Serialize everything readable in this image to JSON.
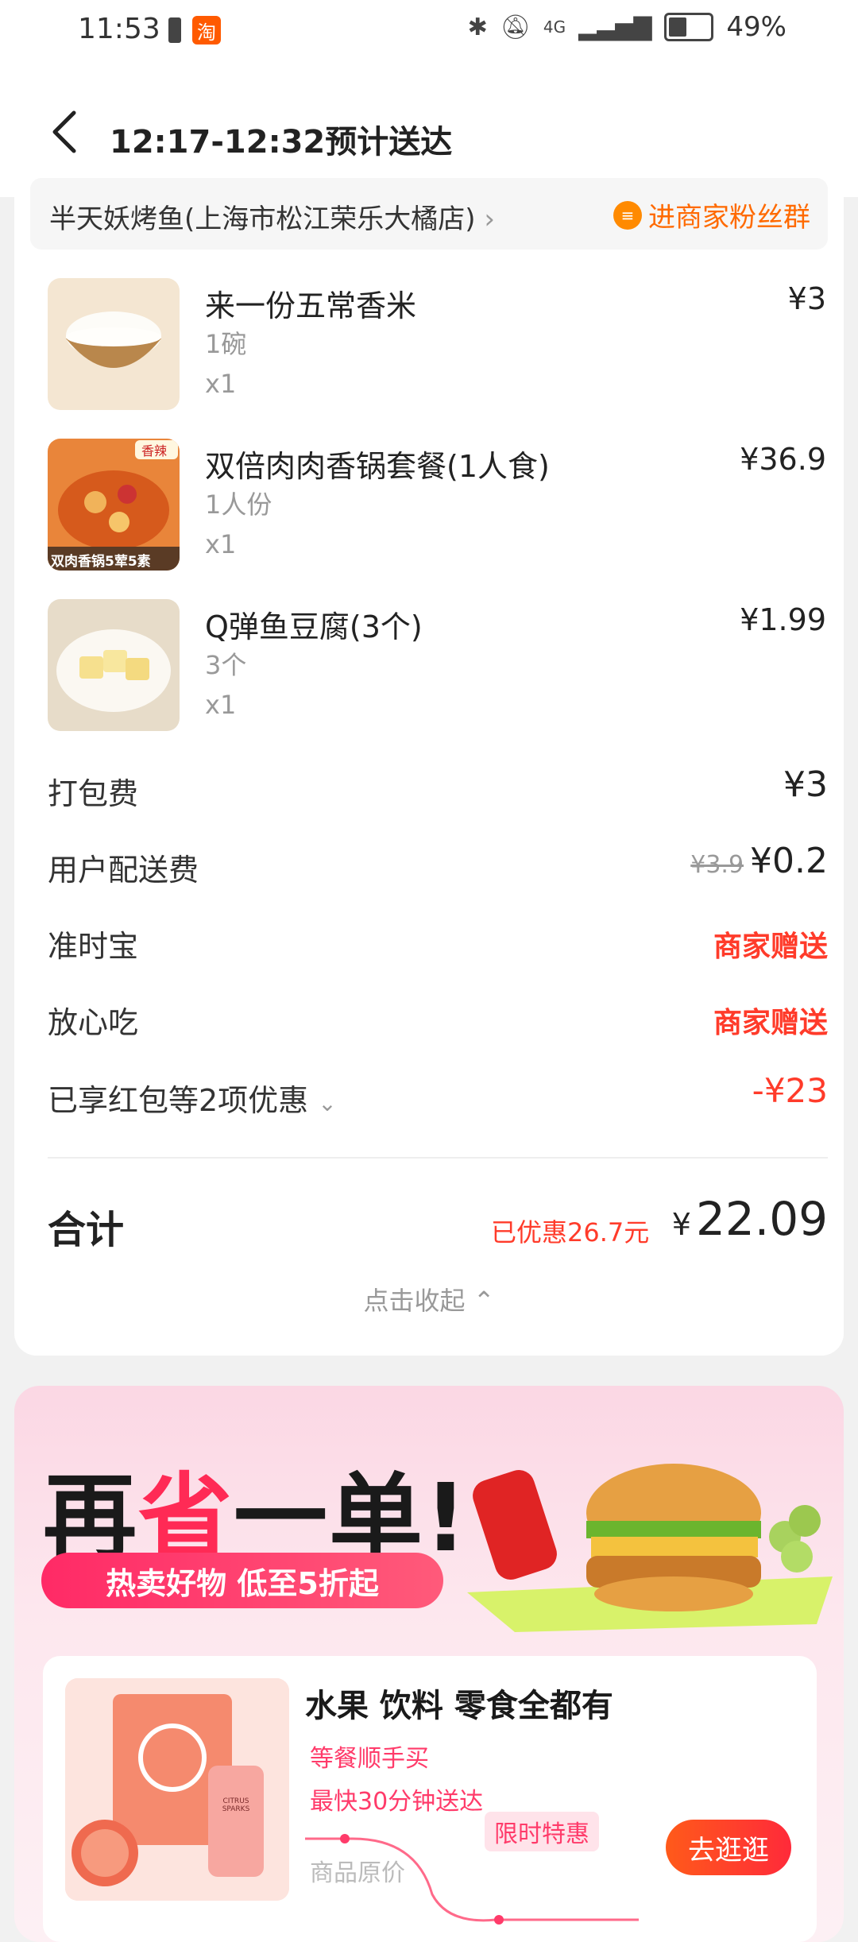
{
  "status_bar": {
    "time": "11:53",
    "taobao_badge": "淘",
    "network": "4G",
    "battery": "49%"
  },
  "header": {
    "title": "12:17-12:32预计送达"
  },
  "store": {
    "name": "半天妖烤鱼(上海市松江荣乐大橘店)",
    "fan_group": "进商家粉丝群"
  },
  "items": [
    {
      "name": "来一份五常香米",
      "spec": "1碗",
      "qty": "x1",
      "price": "¥3"
    },
    {
      "name": "双倍肉肉香锅套餐(1人食)",
      "spec": "1人份",
      "qty": "x1",
      "price": "¥36.9",
      "badge": "香辣",
      "caption": "双肉香锅5荤5素"
    },
    {
      "name": "Q弹鱼豆腐(3个)",
      "spec": "3个",
      "qty": "x1",
      "price": "¥1.99"
    }
  ],
  "fees": {
    "packing": {
      "label": "打包费",
      "value": "¥3"
    },
    "delivery": {
      "label": "用户配送费",
      "original": "¥3.9",
      "value": "¥0.2"
    },
    "on_time": {
      "label": "准时宝",
      "value": "商家赠送"
    },
    "safe_eat": {
      "label": "放心吃",
      "value": "商家赠送"
    },
    "discount": {
      "label": "已享红包等2项优惠",
      "value": "-¥23"
    }
  },
  "total": {
    "label": "合计",
    "saved": "已优惠26.7元",
    "currency": "¥",
    "amount": "22.09",
    "collapse": "点击收起"
  },
  "promo": {
    "title_a": "再",
    "title_hl": "省",
    "title_b": "一单!",
    "pill": "热卖好物 低至5折起",
    "sub_title": "水果 饮料 零食全都有",
    "line1": "等餐顺手买",
    "line2": "最快30分钟送达",
    "orig_price": "商品原价",
    "limited": "限时特惠",
    "button": "去逛逛",
    "can_text": "CITRUS SPARKS"
  }
}
